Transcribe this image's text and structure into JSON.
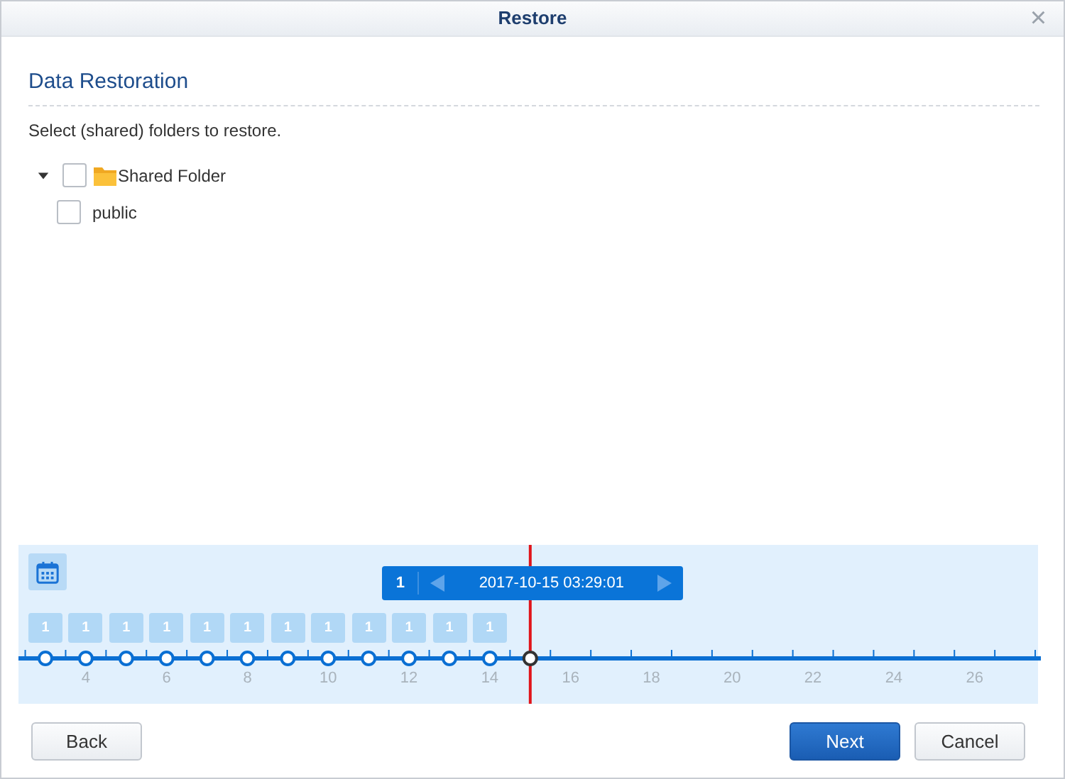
{
  "window": {
    "title": "Restore",
    "close": "×"
  },
  "section_title": "Data Restoration",
  "instruction": "Select (shared) folders to restore.",
  "tree": [
    {
      "label": "Shared Folder",
      "kind": "folder",
      "expanded": true,
      "checked": false,
      "children": [
        {
          "label": "public",
          "checked": false
        }
      ]
    }
  ],
  "timeline": {
    "snapshots": [
      {
        "count": "1",
        "selected": false
      },
      {
        "count": "1",
        "selected": false
      },
      {
        "count": "1",
        "selected": false
      },
      {
        "count": "1",
        "selected": false
      },
      {
        "count": "1",
        "selected": false
      },
      {
        "count": "1",
        "selected": false
      },
      {
        "count": "1",
        "selected": false
      },
      {
        "count": "1",
        "selected": false
      },
      {
        "count": "1",
        "selected": false
      },
      {
        "count": "1",
        "selected": false
      },
      {
        "count": "1",
        "selected": false
      },
      {
        "count": "1",
        "selected": false
      },
      {
        "selected": true
      }
    ],
    "axis_labels": [
      "4",
      "6",
      "8",
      "10",
      "12",
      "14",
      "16",
      "18",
      "20",
      "22",
      "24",
      "26"
    ],
    "popup": {
      "count": "1",
      "datetime": "2017-10-15 03:29:01"
    }
  },
  "buttons": [
    {
      "label": "Back",
      "kind": "default"
    },
    {
      "label": "Next",
      "kind": "primary"
    },
    {
      "label": "Cancel",
      "kind": "default"
    }
  ]
}
